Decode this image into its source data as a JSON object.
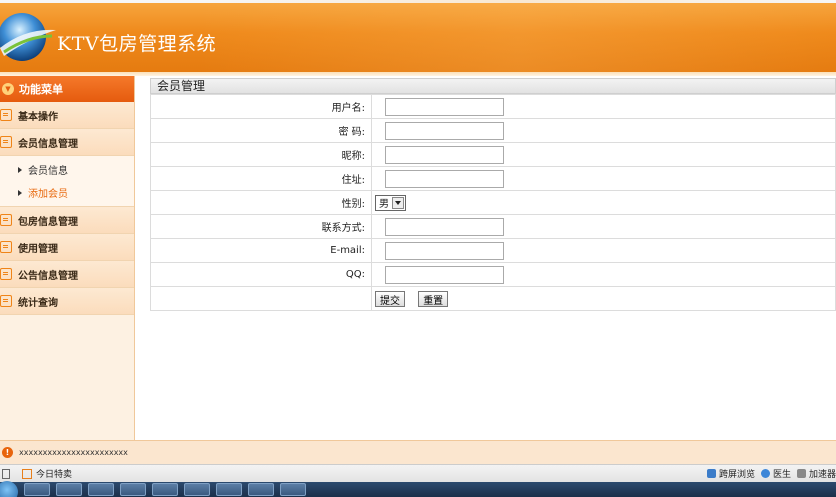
{
  "app": {
    "title": "KTV包房管理系统"
  },
  "sidebar": {
    "header": "功能菜单",
    "items": [
      {
        "label": "基本操作"
      },
      {
        "label": "会员信息管理"
      },
      {
        "label": "包房信息管理"
      },
      {
        "label": "使用管理"
      },
      {
        "label": "公告信息管理"
      },
      {
        "label": "统计查询"
      }
    ],
    "sub_items": [
      {
        "label": "会员信息"
      },
      {
        "label": "添加会员"
      }
    ]
  },
  "main": {
    "panel_title": "会员管理",
    "fields": {
      "username": {
        "label": "用户名:",
        "value": ""
      },
      "password": {
        "label": "密 码:",
        "value": ""
      },
      "nickname": {
        "label": "昵称:",
        "value": ""
      },
      "address": {
        "label": "住址:",
        "value": ""
      },
      "gender": {
        "label": "性别:",
        "selected": "男"
      },
      "contact": {
        "label": "联系方式:",
        "value": ""
      },
      "email": {
        "label": "E-mail:",
        "value": ""
      },
      "qq": {
        "label": "QQ:",
        "value": ""
      }
    },
    "submit_label": "提交",
    "reset_label": "重置"
  },
  "statusbar": {
    "text": "xxxxxxxxxxxxxxxxxxxxxxx"
  },
  "browserbar": {
    "today_label": "今日特卖",
    "split_view_label": "跨屏浏览",
    "doctor_label": "医生",
    "accelerator_label": "加速器"
  },
  "colors": {
    "accent": "#ef8a1c",
    "sidebar_head": "#e55b0e",
    "sidebar_bg": "#fdf1e2"
  }
}
